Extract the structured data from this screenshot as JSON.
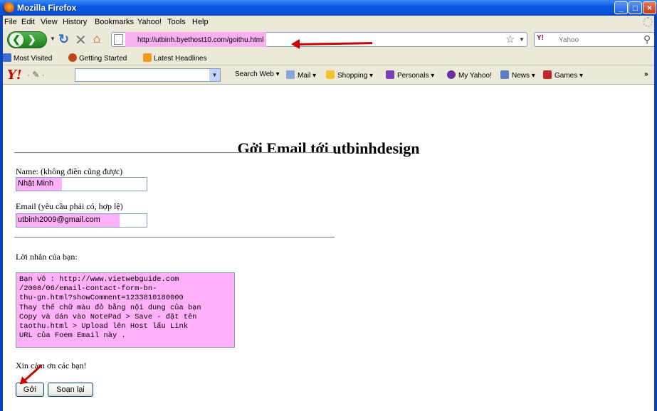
{
  "window": {
    "title": "Mozilla Firefox"
  },
  "menu": [
    "File",
    "Edit",
    "View",
    "History",
    "Bookmarks",
    "Yahoo!",
    "Tools",
    "Help"
  ],
  "nav": {
    "url": "http://utbinh.byethost10.com/goithu.html",
    "search_engine": "Y!",
    "search_placeholder": "Yahoo"
  },
  "bookmarks": [
    "Most Visited",
    "Getting Started",
    "Latest Headlines"
  ],
  "yahoo_toolbar": {
    "logo": "Y!",
    "items": [
      "Search Web",
      "Mail",
      "Shopping",
      "Personals",
      "My Yahoo!",
      "News",
      "Games"
    ],
    "more": "»"
  },
  "page": {
    "heading": "Gởi Email tới utbinhdesign",
    "name_label": "Name: (không điền cũng được)",
    "name_value": "Nhật Minh",
    "email_label": "Email (yêu cầu phải có, hợp lệ)",
    "email_value": "utbinh2009@gmail.com",
    "message_label": "Lời nhắn của bạn:",
    "message_text": "Bạn vô : http://www.vietwebguide.com\n/2008/06/email-contact-form-bn-\nthu-gn.html?showComment=1233810180000\nThay thế chữ màu đỏ bằng nội dung của bạn\nCopy và dán vào NotePad > Save - đặt tên\ntaothu.html > Upload lên Host lấu Link\nURL của Foem Email này .",
    "thanks": "Xin cảm ơn các bạn!",
    "submit_label": "Gởi",
    "reset_label": "Soạn lại"
  },
  "colors": {
    "highlight": "#ffb0f8",
    "arrow": "#cc0000",
    "titlebar": "#0552d8"
  }
}
